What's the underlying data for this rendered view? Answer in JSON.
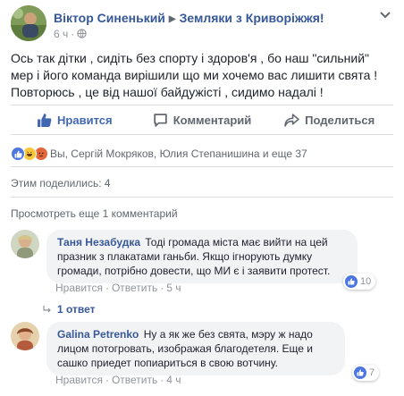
{
  "post": {
    "author": "Віктор Синенький",
    "group": "Земляки з Криворіжжя!",
    "time": "6 ч",
    "text": "Ось так дітки , сидіть без спорту і здоров'я , бо наш \"сильний\" мер і його команда вирішили що ми хочемо вас лишити свята ! Повторюсь , це від нашої байдужісті , сидимо надалі !"
  },
  "actions": {
    "like": "Нравится",
    "comment": "Комментарий",
    "share": "Поделиться"
  },
  "reactions": {
    "summary": "Вы, Сергій Мокряков, Юлия Степанишина и еще 37",
    "types": [
      "like",
      "haha",
      "angry"
    ]
  },
  "shares": "Этим поделились: 4",
  "more_comments": "Просмотреть еще 1 комментарий",
  "comments": [
    {
      "author": "Таня Незабудка",
      "text": "Тоді громада міста має вийти на цей празник з плакатами ганьби. Якщо ігнорують думку громади, потрібно довести, що МИ є і заявити протест.",
      "like": "Нравится",
      "reply": "Ответить",
      "time": "5 ч",
      "reaction_count": "10"
    },
    {
      "author": "Galina Petrenko",
      "text": "Ну а як же без свята, мэру ж надо лицом потогровать, изображая благодетеля. Еще и сашко приедет попиариться в свою вотчину.",
      "like": "Нравится",
      "reply": "Ответить",
      "time": "4 ч",
      "reaction_count": "7"
    }
  ],
  "reply_count": "1 ответ",
  "colors": {
    "link": "#365899",
    "like_active": "#4267b2",
    "bubble": "#f2f3f5",
    "muted": "#90949c"
  }
}
